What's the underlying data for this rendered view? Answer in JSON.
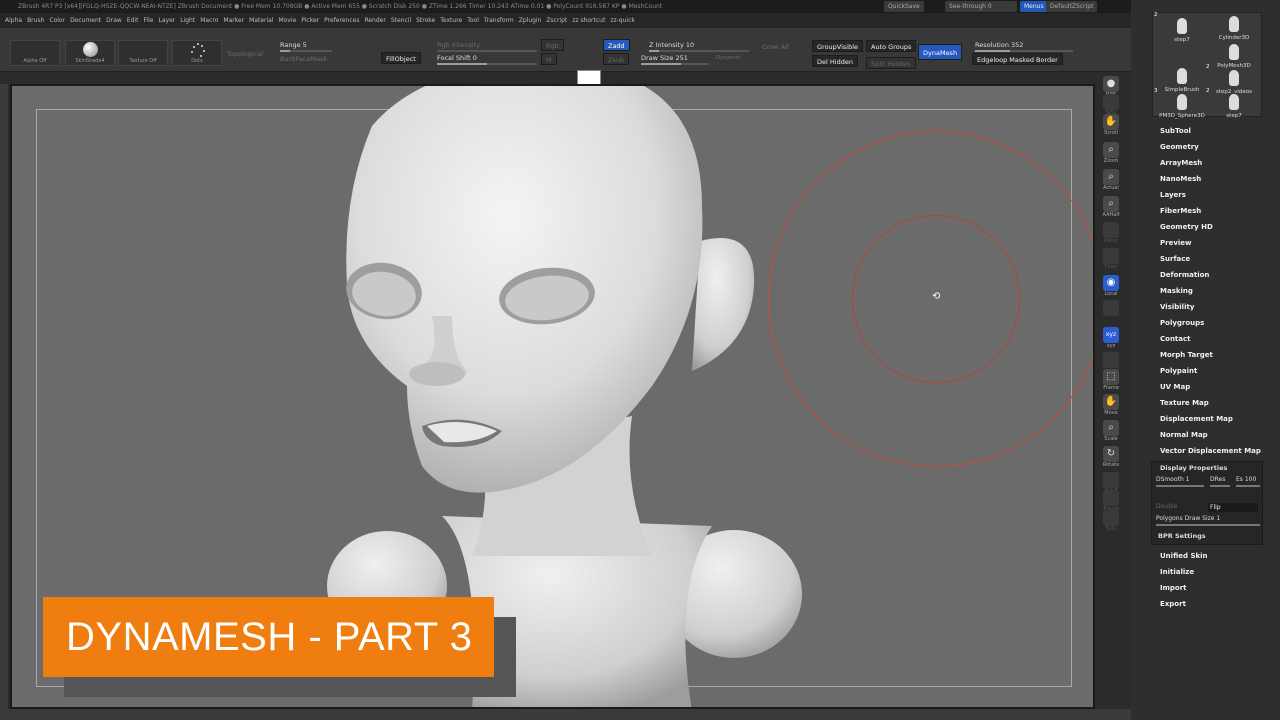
{
  "window": {
    "status": "ZBrush 4R7 P3 [x64][FGLQ-HSZE-QQCW-NEAI-NTZE]   ZBrush Document   ● Free Mem 10.708GB ● Active Mem 655 ● Scratch Disk 250 ● ZTime 1.266 Timer 10.243 ATime 0.01 ● PolyCount 916.587 KP ● MeshCount",
    "quicksave": "QuickSave",
    "see_through": "See-through  0",
    "menus": "Menus",
    "default_zscript": "DefaultZScript"
  },
  "menubar": [
    "Alpha",
    "Brush",
    "Color",
    "Document",
    "Draw",
    "Edit",
    "File",
    "Layer",
    "Light",
    "Macro",
    "Marker",
    "Material",
    "Movie",
    "Picker",
    "Preferences",
    "Render",
    "Stencil",
    "Stroke",
    "Texture",
    "Tool",
    "Transform",
    "Zplugin",
    "Zscript",
    "zz shortcut",
    "zz-quick"
  ],
  "shelf": {
    "alpha": "Alpha Off",
    "brush": "SkinShade4",
    "texture": "Texture Off",
    "stroke": "Dots",
    "topological": "Topological",
    "range": "Range 5",
    "backfacemask": "BackFaceMask",
    "fillobject": "FillObject",
    "rgb_intensity": "Rgb Intensity",
    "focal_shift": "Focal Shift 0",
    "rgb": "Rgb",
    "m": "M",
    "zadd": "Zadd",
    "zsub": "Zsub",
    "z_intensity": "Z Intensity 10",
    "draw_size": "Draw Size 251",
    "dynamic": "Dynamic",
    "grow_all": "Grow All",
    "groupvisible": "GroupVisible",
    "auto_groups": "Auto Groups",
    "del_hidden": "Del Hidden",
    "split_hidden": "Split Hidden",
    "dynamesh": "DynaMesh",
    "resolution": "Resolution 352",
    "edgeloop": "Edgeloop Masked Border"
  },
  "right_tools": [
    {
      "label": "BPR",
      "icon": "render-icon",
      "glyph": "●",
      "state": "normal"
    },
    {
      "label": "SPix",
      "icon": "spix-icon",
      "glyph": "",
      "state": "dim"
    },
    {
      "label": "Scroll",
      "icon": "scroll-icon",
      "glyph": "✋",
      "state": "normal"
    },
    {
      "label": "Zoom",
      "icon": "zoom-icon",
      "glyph": "⌕",
      "state": "normal"
    },
    {
      "label": "Actual",
      "icon": "actual-icon",
      "glyph": "⌕",
      "state": "normal"
    },
    {
      "label": "AAHalf",
      "icon": "aahalf-icon",
      "glyph": "⌕",
      "state": "normal"
    },
    {
      "label": "Persp",
      "icon": "persp-icon",
      "glyph": "",
      "state": "dim"
    },
    {
      "label": "Floor",
      "icon": "floor-icon",
      "glyph": "",
      "state": "dim"
    },
    {
      "label": "Local",
      "icon": "local-icon",
      "glyph": "◉",
      "state": "active"
    },
    {
      "label": "",
      "icon": "lsym-icon",
      "glyph": "",
      "state": "dim"
    },
    {
      "label": "xyz",
      "icon": "xyz-icon",
      "glyph": "xyz",
      "state": "active"
    },
    {
      "label": "",
      "icon": "rotate-lock-icon",
      "glyph": "",
      "state": "dim"
    },
    {
      "label": "Frame",
      "icon": "frame-icon",
      "glyph": "⬚",
      "state": "normal"
    },
    {
      "label": "Move",
      "icon": "move-icon",
      "glyph": "✋",
      "state": "normal"
    },
    {
      "label": "Scale",
      "icon": "scale-icon",
      "glyph": "⌕",
      "state": "normal"
    },
    {
      "label": "Rotate",
      "icon": "rotate-icon",
      "glyph": "↻",
      "state": "normal"
    },
    {
      "label": "PolyF",
      "icon": "polyframe-icon",
      "glyph": "",
      "state": "dim"
    },
    {
      "label": "Transp",
      "icon": "transp-icon",
      "glyph": "",
      "state": "dim"
    },
    {
      "label": "Solo",
      "icon": "solo-icon",
      "glyph": "",
      "state": "dim"
    }
  ],
  "tool_thumbs": [
    {
      "num": "2",
      "name": "step7"
    },
    {
      "num": "",
      "name": "Cylinder3D"
    },
    {
      "num": "",
      "name": "SimpleBrush"
    },
    {
      "num": "",
      "name": "PolyMesh3D"
    },
    {
      "num": "3",
      "name": "PM3D_Sphere3D"
    },
    {
      "num": "2",
      "name": "step2_videos"
    },
    {
      "num": "2",
      "name": "step7"
    }
  ],
  "tool_menu": [
    "SubTool",
    "Geometry",
    "ArrayMesh",
    "NanoMesh",
    "Layers",
    "FiberMesh",
    "Geometry HD",
    "Preview",
    "Surface",
    "Deformation",
    "Masking",
    "Visibility",
    "Polygroups",
    "Contact",
    "Morph Target",
    "Polypaint",
    "UV Map",
    "Texture Map",
    "Displacement Map",
    "Normal Map",
    "Vector Displacement Map"
  ],
  "display_properties": {
    "title": "Display Properties",
    "dsmooth": "DSmooth 1",
    "dres": "DRes",
    "es": "Es 100",
    "double": "Double",
    "flip": "Flip",
    "polygons_draw_size": "Polygons Draw Size 1",
    "bpr_settings": "BPR Settings"
  },
  "tool_menu_bottom": [
    "Unified Skin",
    "Initialize",
    "Import",
    "Export"
  ],
  "banner": {
    "text": "DYNAMESH - PART 3"
  },
  "colors": {
    "accent_blue": "#2559bd",
    "banner_orange": "#ef7d10",
    "brush_circle": "#c74e3e",
    "canvas_bg": "#6b6b6b"
  }
}
